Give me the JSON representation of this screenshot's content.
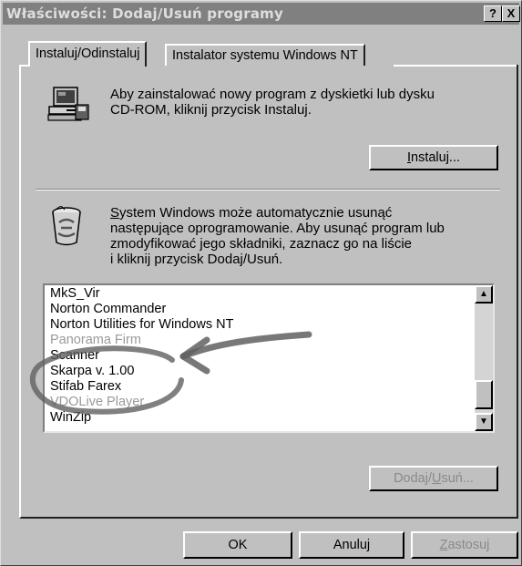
{
  "window": {
    "title": "Właściwości: Dodaj/Usuń programy",
    "help_button": "?",
    "close_button": "X"
  },
  "tabs": [
    {
      "label": "Instaluj/Odinstaluj",
      "active": true
    },
    {
      "label": "Instalator systemu Windows NT",
      "active": false
    }
  ],
  "install_section": {
    "text_line1": "Aby zainstalować nowy program z dyskietki lub dysku",
    "text_line2": "CD-ROM, kliknij przycisk Instaluj.",
    "install_button": {
      "accel": "I",
      "rest": "nstaluj..."
    }
  },
  "uninstall_section": {
    "line1_accel": "S",
    "line1_rest": "ystem Windows może automatycznie usunąć",
    "line2": "następujące oprogramowanie. Aby usunąć program lub",
    "line3": "zmodyfikować jego składniki, zaznacz go na liście",
    "line4": "i kliknij przycisk Dodaj/Usuń."
  },
  "program_list": {
    "items": [
      "MkS_Vir",
      "Norton Commander",
      "Norton Utilities for Windows NT",
      "Panorama Firm",
      "Scanner",
      "Skarpa v. 1.00",
      "Stifab Farex",
      "VDOLive Player",
      "WinZip"
    ],
    "scroll_up": "▲",
    "scroll_down": "▼"
  },
  "add_remove_button": {
    "before": "Dodaj/",
    "accel": "U",
    "after": "suń..."
  },
  "footer": {
    "ok": "OK",
    "cancel": "Anuluj",
    "apply_accel": "Z",
    "apply_rest": "astosuj"
  },
  "colors": {
    "face": "#c0c0c0",
    "titlebar": "#808080",
    "disabled_text": "#8a8a8a",
    "annotation_arrow": "#606060"
  }
}
